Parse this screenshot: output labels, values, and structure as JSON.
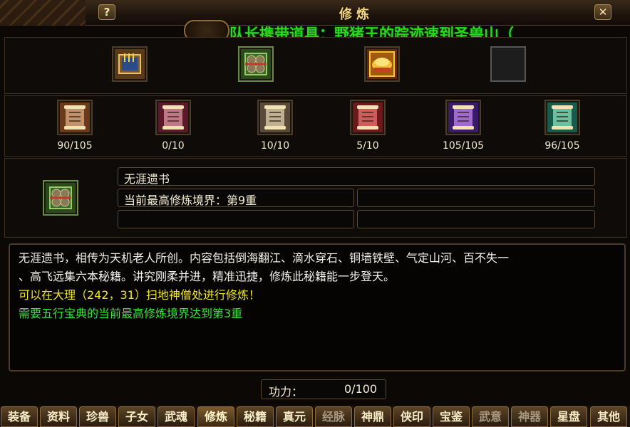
{
  "window": {
    "title": "修炼",
    "help_label": "?",
    "close_label": "✕",
    "marquee": "队长携带道具：野猪王的踪迹速到圣兽山（"
  },
  "top_items": [
    {
      "icon": "book-icon",
      "colors": [
        "#7a5a2a",
        "#d2a24a"
      ]
    },
    {
      "icon": "scroll-bundle-icon",
      "colors": [
        "#3a6a2a",
        "#9ac86a"
      ]
    },
    {
      "icon": "gold-treasure-icon",
      "colors": [
        "#a05a10",
        "#f2c23a"
      ]
    },
    {
      "icon": "empty-slot",
      "colors": [
        "#1d1d1d",
        "#1d1d1d"
      ]
    }
  ],
  "scrolls": [
    {
      "count": "90/105",
      "colors": [
        "#6a3a1a",
        "#d2a27a"
      ]
    },
    {
      "count": "0/10",
      "colors": [
        "#5a1a2a",
        "#d28a9a"
      ]
    },
    {
      "count": "10/10",
      "colors": [
        "#5a4a3a",
        "#d2c2a2"
      ]
    },
    {
      "count": "5/10",
      "colors": [
        "#6a1a1a",
        "#e26a6a"
      ]
    },
    {
      "count": "105/105",
      "colors": [
        "#3a1a6a",
        "#b27ae2"
      ]
    },
    {
      "count": "96/105",
      "colors": [
        "#1a5a4a",
        "#7ad2b2"
      ]
    }
  ],
  "info": {
    "name": "无涯遗书",
    "realm": "当前最高修炼境界：第9重",
    "field3": "",
    "field4": "",
    "field5": ""
  },
  "description": {
    "line1": "无涯遗书，相传为天机老人所创。内容包括倒海翻江、滴水穿石、铜墙铁壁、气定山河、百不失一",
    "line2": "、高飞远集六本秘籍。讲究刚柔并进，精准迅捷，修炼此秘籍能一步登天。",
    "location": "可以在大理（242，31）扫地神僧处进行修炼！",
    "requirement": "需要五行宝典的当前最高修炼境界达到第3重"
  },
  "gongli": {
    "label": "功力：",
    "value": "0/100"
  },
  "tabs": [
    {
      "label": "装备",
      "state": "normal"
    },
    {
      "label": "资料",
      "state": "normal"
    },
    {
      "label": "珍兽",
      "state": "normal"
    },
    {
      "label": "子女",
      "state": "normal"
    },
    {
      "label": "武魂",
      "state": "normal"
    },
    {
      "label": "修炼",
      "state": "active"
    },
    {
      "label": "秘籍",
      "state": "normal"
    },
    {
      "label": "真元",
      "state": "normal"
    },
    {
      "label": "经脉",
      "state": "dim"
    },
    {
      "label": "神鼎",
      "state": "normal"
    },
    {
      "label": "侠印",
      "state": "normal"
    },
    {
      "label": "宝鉴",
      "state": "normal"
    },
    {
      "label": "武意",
      "state": "dim"
    },
    {
      "label": "神器",
      "state": "dim"
    },
    {
      "label": "星盘",
      "state": "normal"
    },
    {
      "label": "其他",
      "state": "normal"
    }
  ]
}
